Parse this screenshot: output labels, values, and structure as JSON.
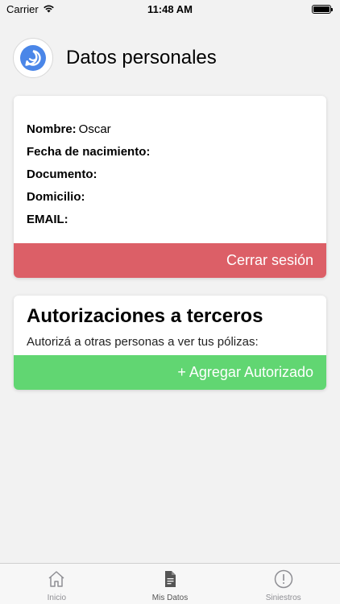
{
  "status_bar": {
    "carrier": "Carrier",
    "time": "11:48 AM"
  },
  "header": {
    "title": "Datos personales",
    "logo_icon": "chat-bubble-logo-icon"
  },
  "profile": {
    "fields": [
      {
        "label": "Nombre:",
        "value": "Oscar"
      },
      {
        "label": "Fecha de nacimiento:",
        "value": ""
      },
      {
        "label": "Documento:",
        "value": ""
      },
      {
        "label": "Domicilio:",
        "value": ""
      },
      {
        "label": "EMAIL:",
        "value": ""
      }
    ],
    "logout_label": "Cerrar sesión"
  },
  "authorizations": {
    "title": "Autorizaciones a terceros",
    "subtitle": "Autorizá a otras personas a ver tus pólizas:",
    "add_label": "+ Agregar Autorizado"
  },
  "tabbar": {
    "tabs": [
      {
        "label": "Inicio",
        "icon": "home-icon",
        "active": false
      },
      {
        "label": "Mis Datos",
        "icon": "document-icon",
        "active": true
      },
      {
        "label": "Siniestros",
        "icon": "alert-circle-icon",
        "active": false
      }
    ]
  },
  "colors": {
    "logout": "#dc5f67",
    "add": "#61d672",
    "logo": "#4a86e8"
  }
}
